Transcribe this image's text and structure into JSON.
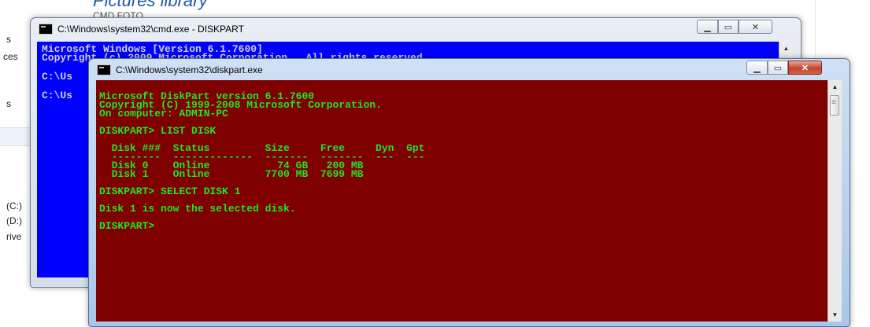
{
  "background": {
    "heading": "Pictures library",
    "subheading": "CMD FOTO",
    "left_fragments": [
      "s",
      "ces",
      "s",
      "(C:)",
      "(D:)",
      "rive"
    ]
  },
  "cmd_window": {
    "title": "C:\\Windows\\system32\\cmd.exe - DISKPART",
    "lines": [
      "Microsoft Windows [Version 6.1.7600]",
      "Copyright (c) 2009 Microsoft Corporation.  All rights reserved.",
      "C:\\Us",
      "C:\\Us"
    ]
  },
  "diskpart_window": {
    "title": "C:\\Windows\\system32\\diskpart.exe",
    "lines": [
      "Microsoft DiskPart version 6.1.7600",
      "Copyright (C) 1999-2008 Microsoft Corporation.",
      "On computer: ADMIN-PC",
      "",
      "DISKPART> LIST DISK",
      "",
      "  Disk ###  Status         Size     Free     Dyn  Gpt",
      "  --------  -------------  -------  -------  ---  ---",
      "  Disk 0    Online           74 GB   200 MB",
      "  Disk 1    Online         7700 MB  7699 MB",
      "",
      "DISKPART> SELECT DISK 1",
      "",
      "Disk 1 is now the selected disk.",
      "",
      "DISKPART> "
    ]
  },
  "colors": {
    "cmd_background": "#0000ff",
    "diskpart_background": "#7f0000",
    "diskpart_text": "#22e522"
  },
  "icons": [
    "console-app-icon",
    "minimize-icon",
    "maximize-icon",
    "close-icon",
    "scroll-up-icon",
    "scroll-down-icon"
  ]
}
